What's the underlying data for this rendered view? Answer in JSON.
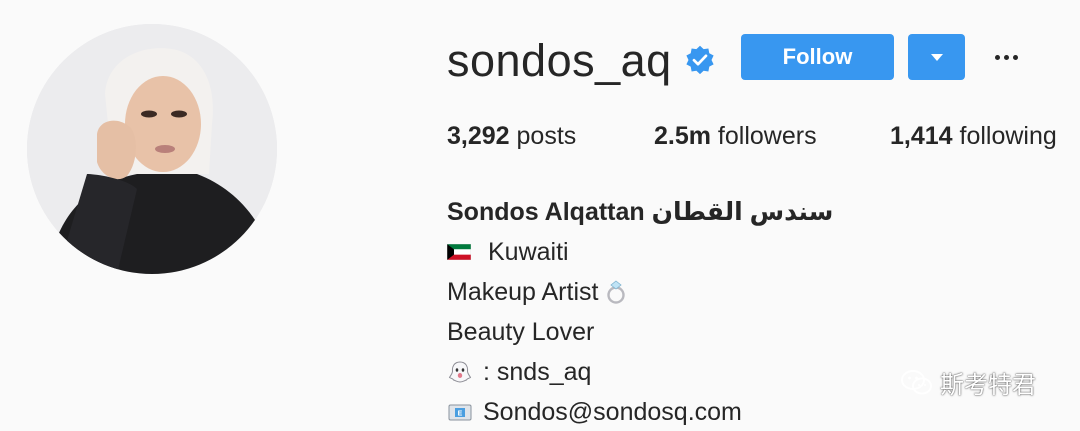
{
  "profile": {
    "username": "sondos_aq",
    "verified_icon": "verified-badge-icon",
    "follow_label": "Follow",
    "dropdown_icon": "caret-down-icon",
    "more_icon": "more-options-icon"
  },
  "stats": {
    "posts_count": "3,292",
    "posts_label": " posts",
    "followers_count": "2.5m",
    "followers_label": " followers",
    "following_count": "1,414",
    "following_label": " following"
  },
  "bio": {
    "full_name": "Sondos Alqattan سندس القطان",
    "line1_icon": "kuwait-flag-icon",
    "line1": "Kuwaiti",
    "line2": "Makeup Artist",
    "line2_icon": "ring-icon",
    "line3": "Beauty Lover",
    "line4_icon": "snapchat-ghost-icon",
    "line4": ": snds_aq",
    "line5_icon": "envelope-icon",
    "line5": "Sondos@sondosq.com"
  },
  "watermark": {
    "icon": "wechat-icon",
    "text": "斯考特君"
  },
  "colors": {
    "background": "#fafafa",
    "follow_button": "#3897f0",
    "verified_badge": "#3897f0",
    "text": "#262626"
  }
}
